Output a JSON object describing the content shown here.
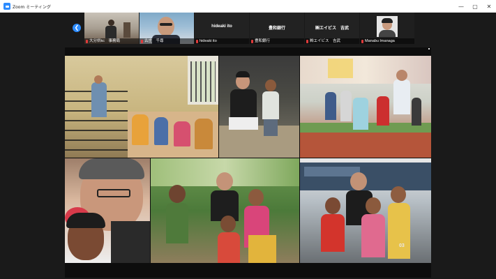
{
  "window": {
    "title": "Zoom ミーティング",
    "controls": {
      "minimize": "—",
      "maximize": "▢",
      "close": "✕"
    }
  },
  "participants": [
    {
      "name": "大分県kc　事務局",
      "muted": true,
      "video": true
    },
    {
      "name": "古庄　千尋",
      "muted": true,
      "video": true
    },
    {
      "name": "hideaki ito",
      "display_name": "hideaki ito",
      "muted": true,
      "video": false
    },
    {
      "name": "豊和銀行",
      "display_name": "豊和銀行",
      "muted": true,
      "video": false
    },
    {
      "name": "㈱エイビス　吉武",
      "display_name": "㈱エイビス　吉武",
      "muted": true,
      "video": false
    },
    {
      "name": "Manabu Imanaga",
      "muted": true,
      "video": false,
      "avatar": true
    }
  ],
  "shared_screen": {
    "photo_number": "03"
  },
  "colors": {
    "accent": "#2d8cff",
    "muted_icon": "#e03b3b",
    "background": "#1a1a1a"
  }
}
